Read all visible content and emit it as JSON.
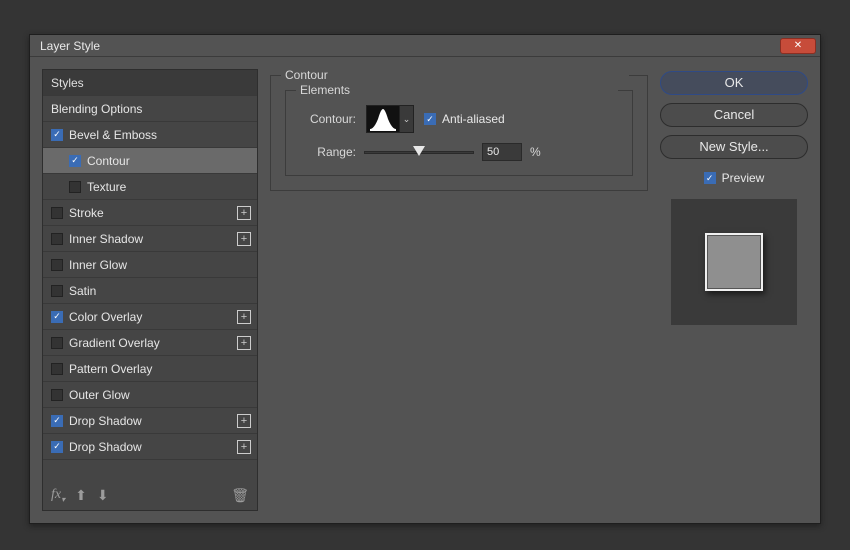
{
  "dialog": {
    "title": "Layer Style"
  },
  "styles_header": "Styles",
  "blending_options": "Blending Options",
  "effects": [
    {
      "label": "Bevel & Emboss",
      "checked": true,
      "plus": false,
      "sub": false
    },
    {
      "label": "Contour",
      "checked": true,
      "plus": false,
      "sub": true,
      "selected": true
    },
    {
      "label": "Texture",
      "checked": false,
      "plus": false,
      "sub": true
    },
    {
      "label": "Stroke",
      "checked": false,
      "plus": true
    },
    {
      "label": "Inner Shadow",
      "checked": false,
      "plus": true
    },
    {
      "label": "Inner Glow",
      "checked": false,
      "plus": false
    },
    {
      "label": "Satin",
      "checked": false,
      "plus": false
    },
    {
      "label": "Color Overlay",
      "checked": true,
      "plus": true
    },
    {
      "label": "Gradient Overlay",
      "checked": false,
      "plus": true
    },
    {
      "label": "Pattern Overlay",
      "checked": false,
      "plus": false
    },
    {
      "label": "Outer Glow",
      "checked": false,
      "plus": false
    },
    {
      "label": "Drop Shadow",
      "checked": true,
      "plus": true
    },
    {
      "label": "Drop Shadow",
      "checked": true,
      "plus": true
    }
  ],
  "center": {
    "section_title": "Contour",
    "group_title": "Elements",
    "contour_label": "Contour:",
    "anti_aliased_label": "Anti-aliased",
    "anti_aliased_checked": true,
    "range_label": "Range:",
    "range_value": "50",
    "range_unit": "%"
  },
  "right": {
    "ok": "OK",
    "cancel": "Cancel",
    "new_style": "New Style...",
    "preview_label": "Preview",
    "preview_checked": true
  }
}
